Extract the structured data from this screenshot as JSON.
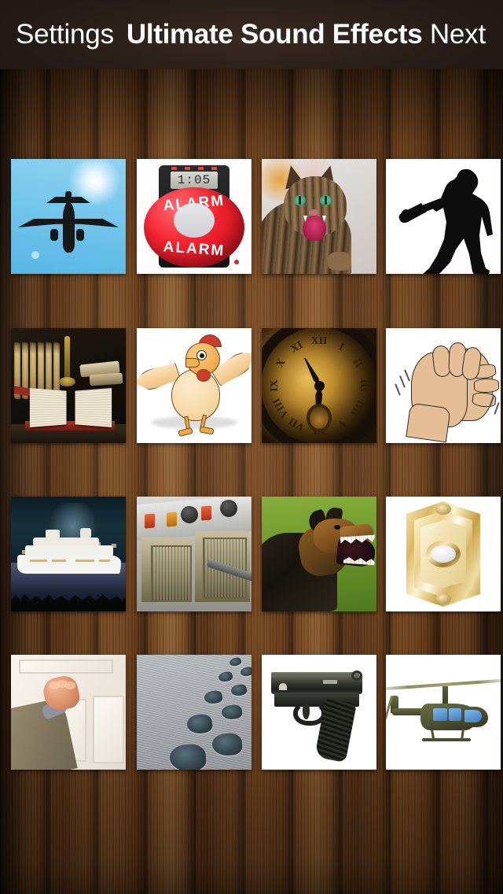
{
  "app": {
    "title": "Ultimate Sound Effects",
    "background": "wood-panel",
    "accent_color": "#1d1512"
  },
  "navbar": {
    "back_label": "Settings",
    "title": "Ultimate Sound Effects",
    "next_label": "Next",
    "background_color": "#241a15",
    "text_color": "#ffffff"
  },
  "grid": {
    "columns": 4,
    "rows": 4,
    "tiles": [
      {
        "index": 1,
        "name": "airplane",
        "label": "Airplane",
        "icon": "airplane-thumbnail"
      },
      {
        "index": 2,
        "name": "alarm",
        "label": "Alarm",
        "icon": "alarm-thumbnail",
        "lcd_text": "1:05",
        "button_text_top": "ALARM",
        "button_text_bottom": "ALARM"
      },
      {
        "index": 3,
        "name": "cat",
        "label": "Cat",
        "icon": "cat-thumbnail"
      },
      {
        "index": 4,
        "name": "baseball",
        "label": "Baseball",
        "icon": "baseball-batter-thumbnail"
      },
      {
        "index": 5,
        "name": "book",
        "label": "Book",
        "icon": "open-book-thumbnail"
      },
      {
        "index": 6,
        "name": "chicken",
        "label": "Chicken",
        "icon": "chicken-thumbnail"
      },
      {
        "index": 7,
        "name": "clock",
        "label": "Clock",
        "icon": "clock-thumbnail"
      },
      {
        "index": 8,
        "name": "clapping",
        "label": "Clapping",
        "icon": "clapping-hands-thumbnail"
      },
      {
        "index": 9,
        "name": "cruise-ship",
        "label": "Cruise Ship",
        "icon": "cruise-ship-thumbnail"
      },
      {
        "index": 10,
        "name": "deep-fryer",
        "label": "Deep Fryer",
        "icon": "deep-fryer-thumbnail"
      },
      {
        "index": 11,
        "name": "dog",
        "label": "Dog",
        "icon": "barking-dog-thumbnail"
      },
      {
        "index": 12,
        "name": "doorbell",
        "label": "Doorbell",
        "icon": "doorbell-thumbnail"
      },
      {
        "index": 13,
        "name": "door-knock",
        "label": "Door Knock",
        "icon": "knocking-hand-thumbnail"
      },
      {
        "index": 14,
        "name": "footsteps",
        "label": "Footsteps",
        "icon": "footprints-snow-thumbnail"
      },
      {
        "index": 15,
        "name": "gun",
        "label": "Gun",
        "icon": "pistol-thumbnail"
      },
      {
        "index": 16,
        "name": "helicopter",
        "label": "Helicopter",
        "icon": "helicopter-thumbnail"
      }
    ]
  },
  "clock_numerals": [
    "XII",
    "I",
    "II",
    "III",
    "IIII",
    "V",
    "VI",
    "VII",
    "VIII",
    "IX",
    "X",
    "XI"
  ]
}
